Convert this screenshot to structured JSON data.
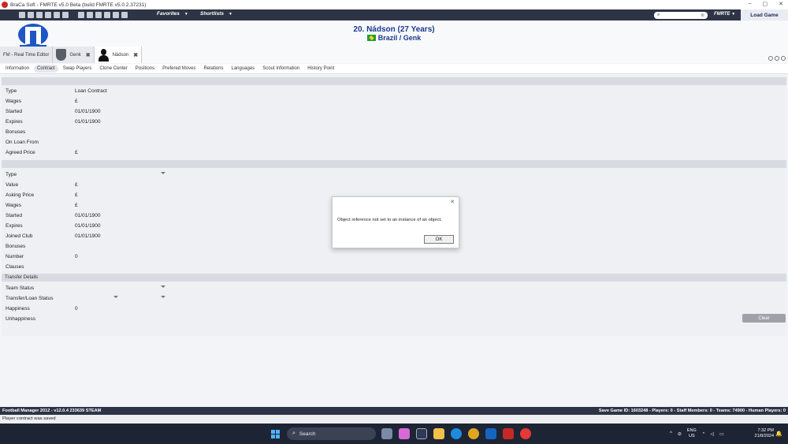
{
  "window": {
    "title": "BraCa Soft - FMRTE v5.0 Beta (build FMRTE v5.0.2.37231)"
  },
  "toolbar": {
    "favorites": "Favorites",
    "shortlists": "Shortlists",
    "search_value": "",
    "fmrte_menu": "FMRTE",
    "load_game": "Load Game"
  },
  "header": {
    "player_title": "20. Nádson (27 Years)",
    "player_sub": "Brazil / Genk"
  },
  "doc_tabs": [
    {
      "label": "FM - Real Time Editor"
    },
    {
      "label": "Genk"
    },
    {
      "label": "Nádson"
    }
  ],
  "subtabs": [
    "Information",
    "Contract",
    "Swap Players",
    "Clone Center",
    "Positions",
    "Prefered Moves",
    "Relations",
    "Languages",
    "Scout Information",
    "History Point"
  ],
  "loan_contract": {
    "rows": [
      {
        "label": "Type",
        "value": "Loan Contract"
      },
      {
        "label": "Wages",
        "value": "£"
      },
      {
        "label": "Started",
        "value": "01/01/1900"
      },
      {
        "label": "Expires",
        "value": "01/01/1900"
      },
      {
        "label": "Bonuses",
        "value": ""
      },
      {
        "label": "On Loan From",
        "value": ""
      },
      {
        "label": "Agreed Price",
        "value": "£"
      }
    ]
  },
  "contract": {
    "rows": [
      {
        "label": "Type",
        "value": ""
      },
      {
        "label": "Value",
        "value": "£"
      },
      {
        "label": "Asking Price",
        "value": "£"
      },
      {
        "label": "Wages",
        "value": "£"
      },
      {
        "label": "Started",
        "value": "01/01/1900"
      },
      {
        "label": "Expires",
        "value": "01/01/1900"
      },
      {
        "label": "Joined Club",
        "value": "01/01/1900"
      },
      {
        "label": "Bonuses",
        "value": ""
      },
      {
        "label": "Number",
        "value": "0"
      },
      {
        "label": "Clauses",
        "value": ""
      }
    ]
  },
  "transfer": {
    "title": "Transfer Details",
    "rows": [
      {
        "label": "Team Status",
        "value": ""
      },
      {
        "label": "Transfer/Loan Status",
        "value": ""
      },
      {
        "label": "Happiness",
        "value": "0"
      },
      {
        "label": "Unhappiness",
        "value": ""
      }
    ],
    "clear_label": "Clear"
  },
  "dialog": {
    "message": "Object reference not set to an instance of an object.",
    "ok_label": "OK",
    "close": "✕"
  },
  "footer": {
    "left": "Football Manager 2012 - v12.0.4 233639 STEAM",
    "right": "Save Game ID: 1603248 - Players: 0 - Staff Members: 0 - Teams: 74900 - Human Players: 0"
  },
  "status": "Player contract was saved",
  "taskbar": {
    "search": "Search",
    "lang1": "ENG",
    "lang2": "US",
    "time": "7:32 PM",
    "date": "21/8/2024"
  },
  "colors": {
    "toolbar_bg": "#2d3445",
    "title_blue": "#1a3a8f",
    "club_blue": "#1e56c6"
  }
}
